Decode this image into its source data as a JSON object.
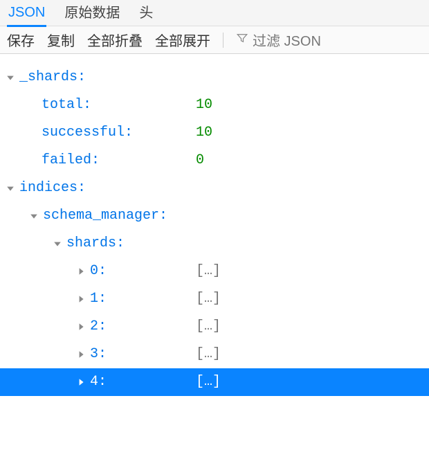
{
  "tabs": {
    "json": "JSON",
    "raw": "原始数据",
    "headers": "头"
  },
  "toolbar": {
    "save": "保存",
    "copy": "复制",
    "collapse_all": "全部折叠",
    "expand_all": "全部展开",
    "filter_placeholder": "过滤 JSON"
  },
  "tree": {
    "shards": {
      "key": "_shards",
      "total": {
        "key": "total",
        "value": "10"
      },
      "successful": {
        "key": "successful",
        "value": "10"
      },
      "failed": {
        "key": "failed",
        "value": "0"
      }
    },
    "indices": {
      "key": "indices",
      "schema_manager": {
        "key": "schema_manager",
        "shards": {
          "key": "shards",
          "items": [
            {
              "key": "0",
              "value": "[…]"
            },
            {
              "key": "1",
              "value": "[…]"
            },
            {
              "key": "2",
              "value": "[…]"
            },
            {
              "key": "3",
              "value": "[…]"
            },
            {
              "key": "4",
              "value": "[…]"
            }
          ]
        }
      }
    }
  }
}
